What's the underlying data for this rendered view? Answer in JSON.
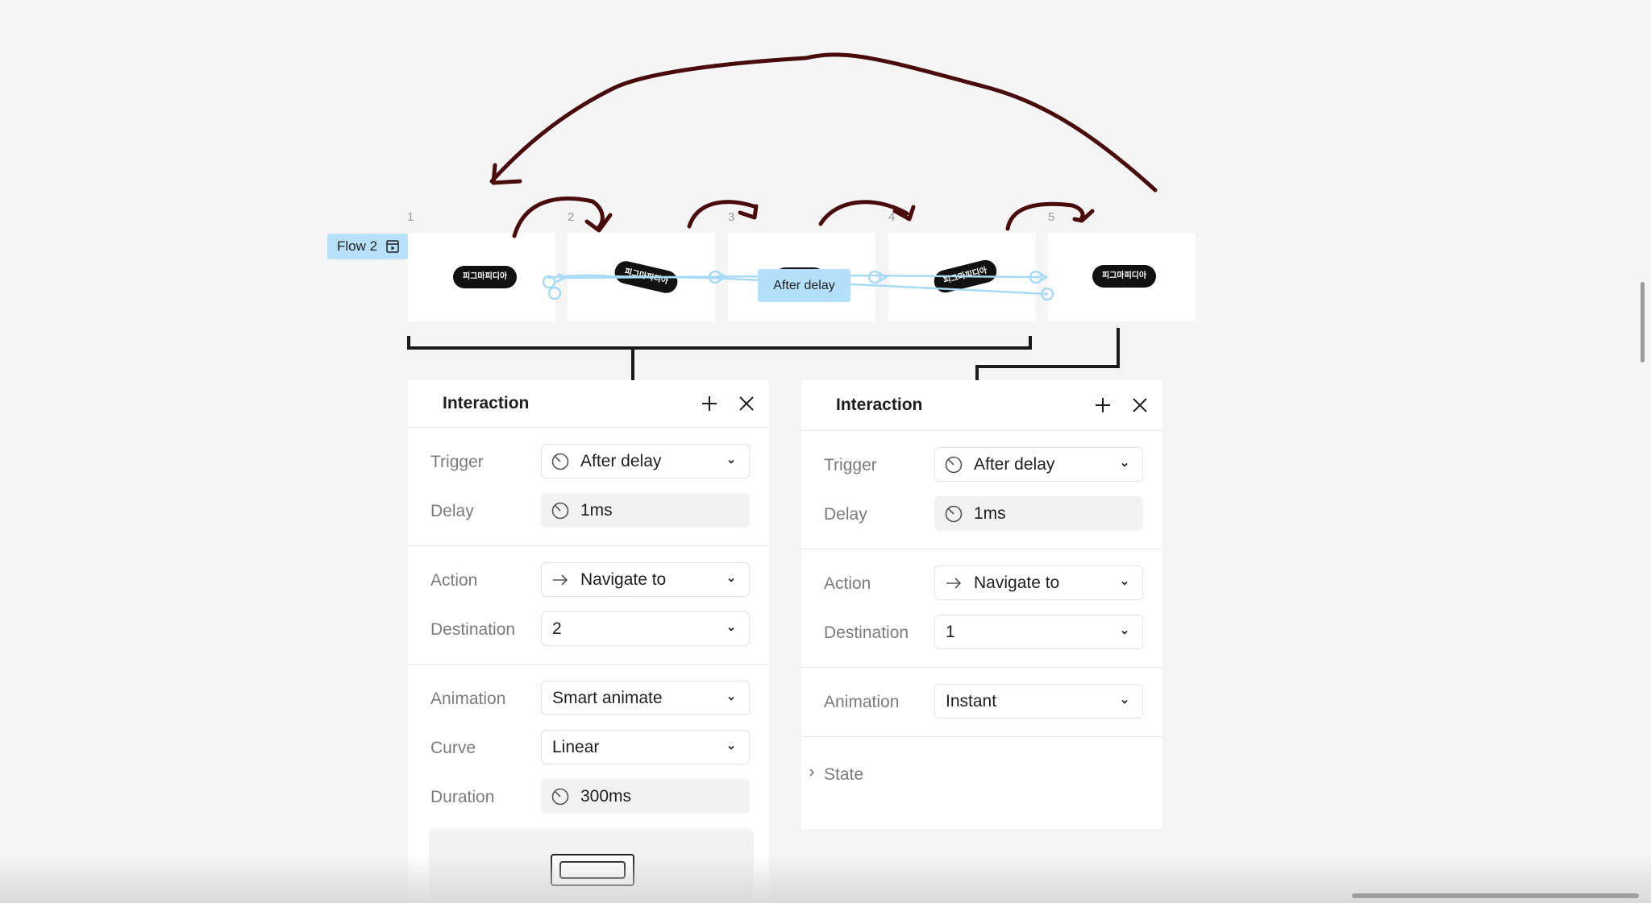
{
  "flow": {
    "label": "Flow 2",
    "icon": "play-frame-icon"
  },
  "frames": [
    {
      "number": "1",
      "pill": "피그마피디아"
    },
    {
      "number": "2",
      "pill": "피그마피디아"
    },
    {
      "number": "3",
      "pill": ""
    },
    {
      "number": "4",
      "pill": "피그마피디아"
    },
    {
      "number": "5",
      "pill": "피그마피디아"
    }
  ],
  "connection_label": "After delay",
  "panel_left": {
    "title": "Interaction",
    "trigger_label": "Trigger",
    "trigger_value": "After delay",
    "delay_label": "Delay",
    "delay_value": "1ms",
    "action_label": "Action",
    "action_value": "Navigate to",
    "destination_label": "Destination",
    "destination_value": "2",
    "animation_label": "Animation",
    "animation_value": "Smart animate",
    "curve_label": "Curve",
    "curve_value": "Linear",
    "duration_label": "Duration",
    "duration_value": "300ms"
  },
  "panel_right": {
    "title": "Interaction",
    "trigger_label": "Trigger",
    "trigger_value": "After delay",
    "delay_label": "Delay",
    "delay_value": "1ms",
    "action_label": "Action",
    "action_value": "Navigate to",
    "destination_label": "Destination",
    "destination_value": "1",
    "animation_label": "Animation",
    "animation_value": "Instant",
    "state_label": "State"
  },
  "colors": {
    "canvas": "#f5f5f5",
    "flow_tag": "#b7e1fb",
    "connector": "#a7daf5",
    "annotation": "#4a0b0b"
  }
}
